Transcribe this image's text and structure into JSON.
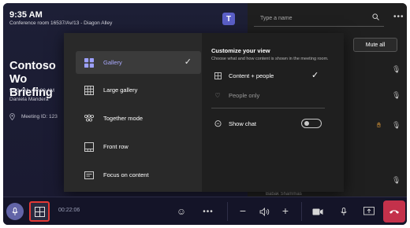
{
  "header": {
    "time": "9:35 AM",
    "room": "Conference room 16537/Av/13 - Diagon Alley",
    "logo": "T"
  },
  "meeting": {
    "title": "Contoso Wo\nBriefing",
    "time": "9:00 AM - 10:00 AM",
    "organizer": "Daniela Mandera",
    "meeting_id": "Meeting ID: 123"
  },
  "roster": {
    "search_placeholder": "Type a name",
    "mute_all_label": "Mute all",
    "participant_name": "Babak Shammas"
  },
  "layout_menu": {
    "items": [
      {
        "label": "Gallery",
        "icon": "gallery-icon",
        "selected": true
      },
      {
        "label": "Large gallery",
        "icon": "large-gallery-icon",
        "selected": false
      },
      {
        "label": "Together mode",
        "icon": "together-mode-icon",
        "selected": false
      },
      {
        "label": "Front row",
        "icon": "front-row-icon",
        "selected": false
      },
      {
        "label": "Focus on content",
        "icon": "focus-content-icon",
        "selected": false
      }
    ]
  },
  "customize": {
    "title": "Customize your view",
    "subtitle": "Choose what and how content is shown in the meeting room.",
    "options": [
      {
        "label": "Content + people",
        "icon": "content-people-icon",
        "selected": true
      },
      {
        "label": "People only",
        "icon": "people-only-icon",
        "selected": false
      }
    ],
    "show_chat_label": "Show chat",
    "show_chat_on": false
  },
  "toolbar": {
    "timer": "00:22:06"
  },
  "colors": {
    "accent": "#6264a7",
    "selected_text": "#aaaaff",
    "hangup": "#c4314b",
    "highlight_border": "#e53935",
    "raised_hand": "#e8a03a"
  }
}
